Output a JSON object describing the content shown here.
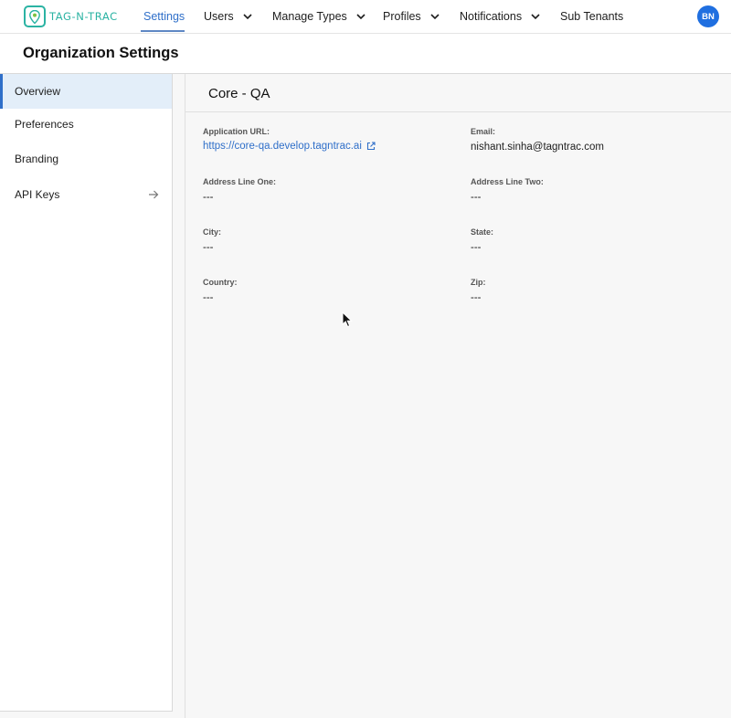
{
  "brand": {
    "logo_text": "TAG-N-TRAC",
    "accent": "#2bb3a3"
  },
  "nav": {
    "items": [
      {
        "label": "Settings",
        "active": true,
        "has_menu": false
      },
      {
        "label": "Users",
        "active": false,
        "has_menu": true
      },
      {
        "label": "Manage Types",
        "active": false,
        "has_menu": true
      },
      {
        "label": "Profiles",
        "active": false,
        "has_menu": true
      },
      {
        "label": "Notifications",
        "active": false,
        "has_menu": true
      },
      {
        "label": "Sub Tenants",
        "active": false,
        "has_menu": false
      }
    ],
    "avatar_initials": "BN"
  },
  "page": {
    "title": "Organization Settings"
  },
  "sidebar": {
    "items": [
      {
        "label": "Overview",
        "active": true
      },
      {
        "label": "Preferences",
        "active": false
      },
      {
        "label": "Branding",
        "active": false
      },
      {
        "label": "API Keys",
        "active": false,
        "icon": "arrow-right-icon"
      }
    ]
  },
  "org": {
    "name": "Core - QA",
    "fields": {
      "application_url": {
        "label": "Application URL:",
        "value": "https://core-qa.develop.tagntrac.ai"
      },
      "email": {
        "label": "Email:",
        "value": "nishant.sinha@tagntrac.com"
      },
      "address_one": {
        "label": "Address Line One:",
        "value": "---"
      },
      "address_two": {
        "label": "Address Line Two:",
        "value": "---"
      },
      "city": {
        "label": "City:",
        "value": "---"
      },
      "state": {
        "label": "State:",
        "value": "---"
      },
      "country": {
        "label": "Country:",
        "value": "---"
      },
      "zip": {
        "label": "Zip:",
        "value": "---"
      }
    }
  },
  "colors": {
    "link": "#2f6fc9",
    "active_bg": "#e3eef9",
    "avatar": "#1f6fe0"
  }
}
